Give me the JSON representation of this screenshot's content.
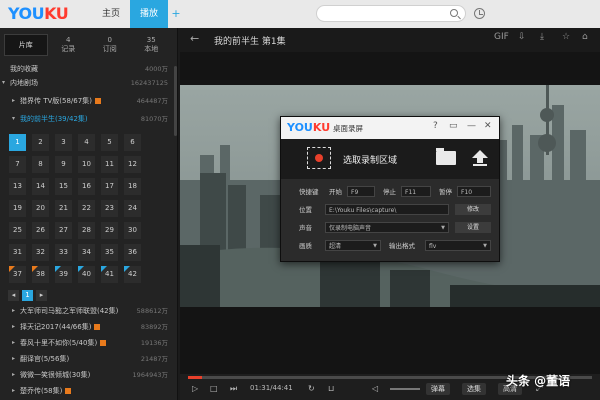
{
  "topbar": {
    "logo_you": "YOU",
    "logo_ku": "KU",
    "tab_home": "主页",
    "tab_play": "播放",
    "tab_add": "+",
    "search_placeholder": ""
  },
  "sidebar": {
    "tabs": [
      {
        "top": "",
        "label": "片库"
      },
      {
        "top": "4",
        "label": "记录"
      },
      {
        "top": "0",
        "label": "订阅"
      },
      {
        "top": "35",
        "label": "本地"
      }
    ],
    "items": [
      {
        "label": "我的收藏",
        "count": "4000万",
        "arrow": "",
        "vip": false
      },
      {
        "label": "内地剧场",
        "count": "162437125",
        "arrow": "▾",
        "vip": false
      },
      {
        "label": "猎界传 TV版(58/67集)",
        "count": "464487万",
        "arrow": "▸",
        "vip": true
      },
      {
        "label": "我的前半生(39/42集)",
        "count": "81070万",
        "arrow": "▾",
        "vip": false
      },
      {
        "label": "大军师司马懿之军师联盟(42集)",
        "count": "588612万",
        "arrow": "▸",
        "vip": false
      },
      {
        "label": "择天记2017(44/66集)",
        "count": "83892万",
        "arrow": "▸",
        "vip": true
      },
      {
        "label": "春风十里不如你(5/40集)",
        "count": "19136万",
        "arrow": "▸",
        "vip": true
      },
      {
        "label": "翻译官(5/56集)",
        "count": "21487万",
        "arrow": "▸",
        "vip": false
      },
      {
        "label": "微微一笑很倾城(30集)",
        "count": "1964943万",
        "arrow": "▸",
        "vip": false
      },
      {
        "label": "楚乔传(58集)",
        "count": "",
        "arrow": "▸",
        "vip": true
      }
    ],
    "episodes": [
      "1",
      "2",
      "3",
      "4",
      "5",
      "6",
      "7",
      "8",
      "9",
      "10",
      "11",
      "12",
      "13",
      "14",
      "15",
      "16",
      "17",
      "18",
      "19",
      "20",
      "21",
      "22",
      "23",
      "24",
      "25",
      "26",
      "27",
      "28",
      "29",
      "30",
      "31",
      "32",
      "33",
      "34",
      "35",
      "36",
      "37",
      "38",
      "39",
      "40",
      "41",
      "42"
    ],
    "current_episode": "1",
    "pager": [
      "◂",
      "1",
      "▸"
    ]
  },
  "player": {
    "title": "我的前半生 第1集",
    "header_icons": [
      "GIF",
      "⇩",
      "⤓",
      "☆",
      "⌂"
    ],
    "time": "01:31/44:41",
    "progress": 0.034,
    "buttons": {
      "danmaku": "弹幕",
      "select": "选集",
      "hd": "高清"
    }
  },
  "recorder": {
    "logo_you": "YOU",
    "logo_ku": "KU",
    "title": "桌面录屏",
    "header_icons": [
      "?",
      "▭",
      "—",
      "✕"
    ],
    "select_label": "选取录制区域",
    "shortcut_label": "快捷键",
    "start_label": "开始",
    "start_key": "F9",
    "stop_label": "停止",
    "stop_key": "F11",
    "pause_label": "暂停",
    "pause_key": "F10",
    "location_label": "位置",
    "location_value": "E:\\Youku Files\\capture\\",
    "modify_btn": "修改",
    "audio_label": "声音",
    "audio_value": "仅录制电脑声音",
    "settings_btn": "设置",
    "quality_label": "画质",
    "quality_value": "超清",
    "format_label": "输出格式",
    "format_value": "flv"
  },
  "watermark": "头条 @董语",
  "colors": {
    "accent": "#2aa7e0",
    "record": "#e8402b",
    "vip": "#e87a1c"
  }
}
